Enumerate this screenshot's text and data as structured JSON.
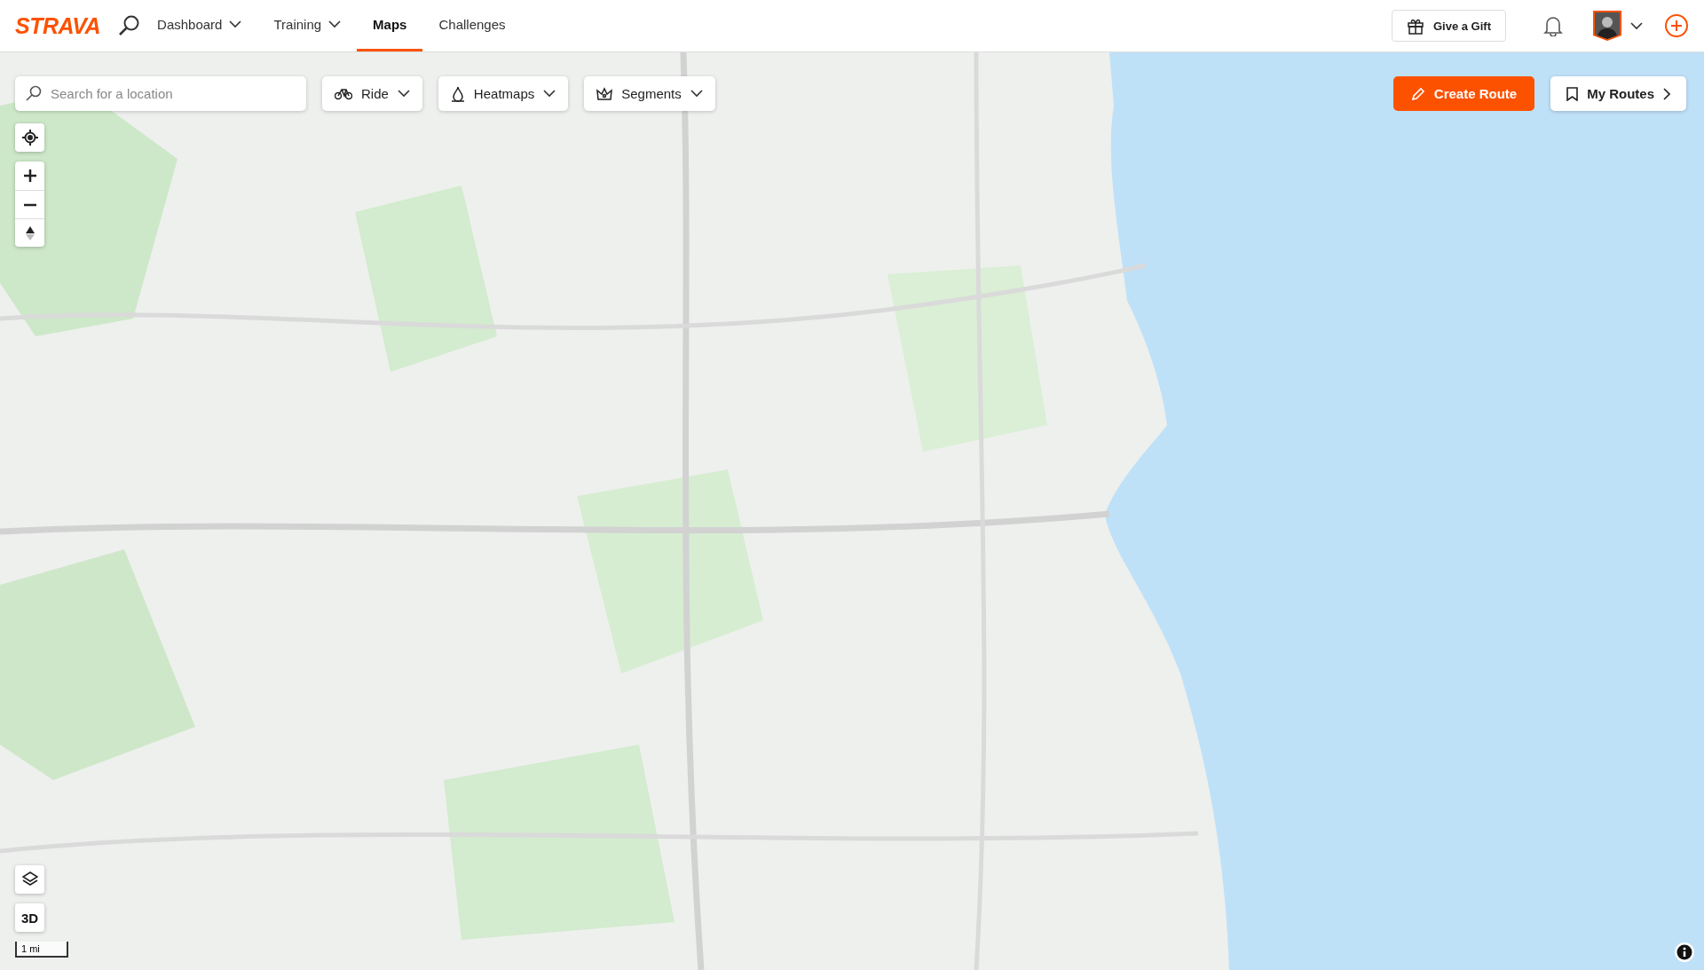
{
  "header": {
    "logo": "STRAVA",
    "nav": [
      {
        "label": "Dashboard",
        "dropdown": true,
        "selected": false
      },
      {
        "label": "Training",
        "dropdown": true,
        "selected": false
      },
      {
        "label": "Maps",
        "dropdown": false,
        "selected": true
      },
      {
        "label": "Challenges",
        "dropdown": false,
        "selected": false
      }
    ],
    "gift_button": "Give a Gift"
  },
  "map": {
    "kind": "picture",
    "search": {
      "placeholder": "Search for a location"
    },
    "filters": [
      {
        "label": "Ride",
        "kind": "bike"
      },
      {
        "label": "Heatmaps",
        "kind": "heatmap"
      },
      {
        "label": "Segments",
        "kind": "segment"
      }
    ],
    "create_route": "Create Route",
    "my_routes": "My Routes",
    "three_d": "3D",
    "scale": "1 mi"
  }
}
